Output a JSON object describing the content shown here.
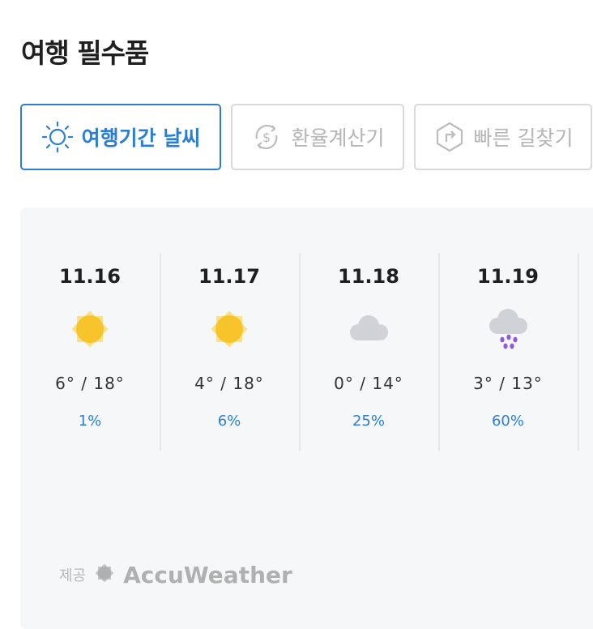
{
  "page": {
    "title": "여행 필수품"
  },
  "tabs": [
    {
      "label": "여행기간 날씨",
      "icon": "sun-outline-icon",
      "active": true
    },
    {
      "label": "환율계산기",
      "icon": "currency-exchange-icon",
      "active": false
    },
    {
      "label": "빠른 길찾기",
      "icon": "directions-icon",
      "active": false
    }
  ],
  "forecast": [
    {
      "date": "11.16",
      "icon": "sunny-icon",
      "temp": "6° / 18°",
      "rain": "1%"
    },
    {
      "date": "11.17",
      "icon": "sunny-icon",
      "temp": "4° / 18°",
      "rain": "6%"
    },
    {
      "date": "11.18",
      "icon": "cloudy-icon",
      "temp": "0° / 14°",
      "rain": "25%"
    },
    {
      "date": "11.19",
      "icon": "rain-cloud-icon",
      "temp": "3° / 13°",
      "rain": "60%"
    }
  ],
  "credit": {
    "label": "제공",
    "brand": "AccuWeather"
  },
  "colors": {
    "accent": "#2a7fd3",
    "sun": "#f7c52b",
    "cloud": "#cfd3d7",
    "rain": "#8e5ad9"
  }
}
